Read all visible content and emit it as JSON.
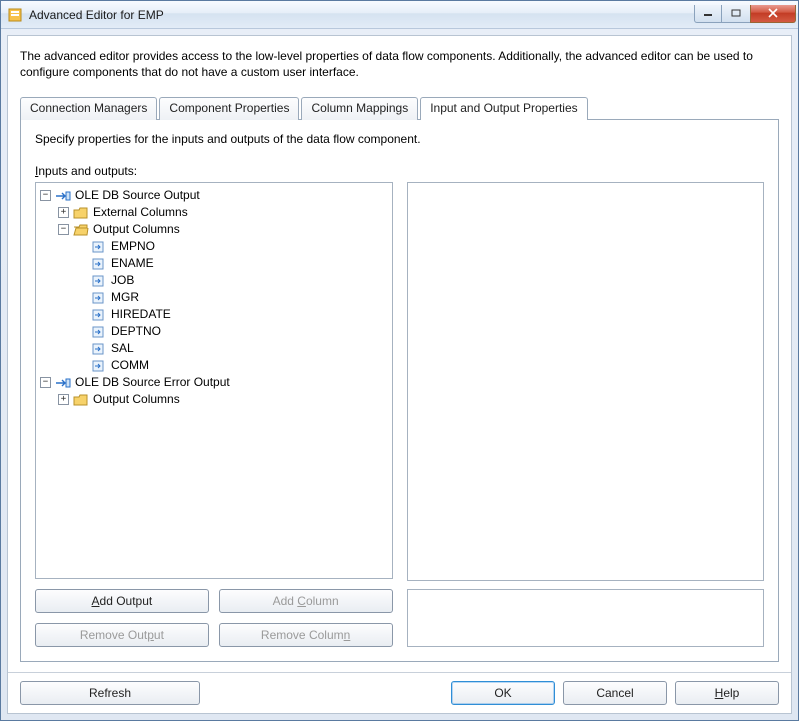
{
  "window": {
    "title": "Advanced Editor for EMP"
  },
  "description": "The advanced editor provides access to the low-level properties of data flow components. Additionally, the advanced editor can be used to configure components that do not have a custom user interface.",
  "tabs": [
    {
      "label": "Connection Managers"
    },
    {
      "label": "Component Properties"
    },
    {
      "label": "Column Mappings"
    },
    {
      "label": "Input and Output Properties"
    }
  ],
  "active_tab_index": 3,
  "panel": {
    "instruction": "Specify properties for the inputs and outputs of the data flow component.",
    "tree_label_pre": "I",
    "tree_label_post": "nputs and outputs:",
    "tree": {
      "source_output": "OLE DB Source Output",
      "external_columns": "External Columns",
      "output_columns": "Output Columns",
      "columns": [
        "EMPNO",
        "ENAME",
        "JOB",
        "MGR",
        "HIREDATE",
        "DEPTNO",
        "SAL",
        "COMM"
      ],
      "error_output": "OLE DB Source Error Output",
      "error_output_columns": "Output Columns"
    },
    "buttons": {
      "add_output": "Add Output",
      "add_column": "Add Column",
      "remove_output": "Remove Output",
      "remove_column": "Remove Column"
    }
  },
  "footer": {
    "refresh": "Refresh",
    "ok": "OK",
    "cancel": "Cancel",
    "help_pre": "H",
    "help_post": "elp"
  }
}
